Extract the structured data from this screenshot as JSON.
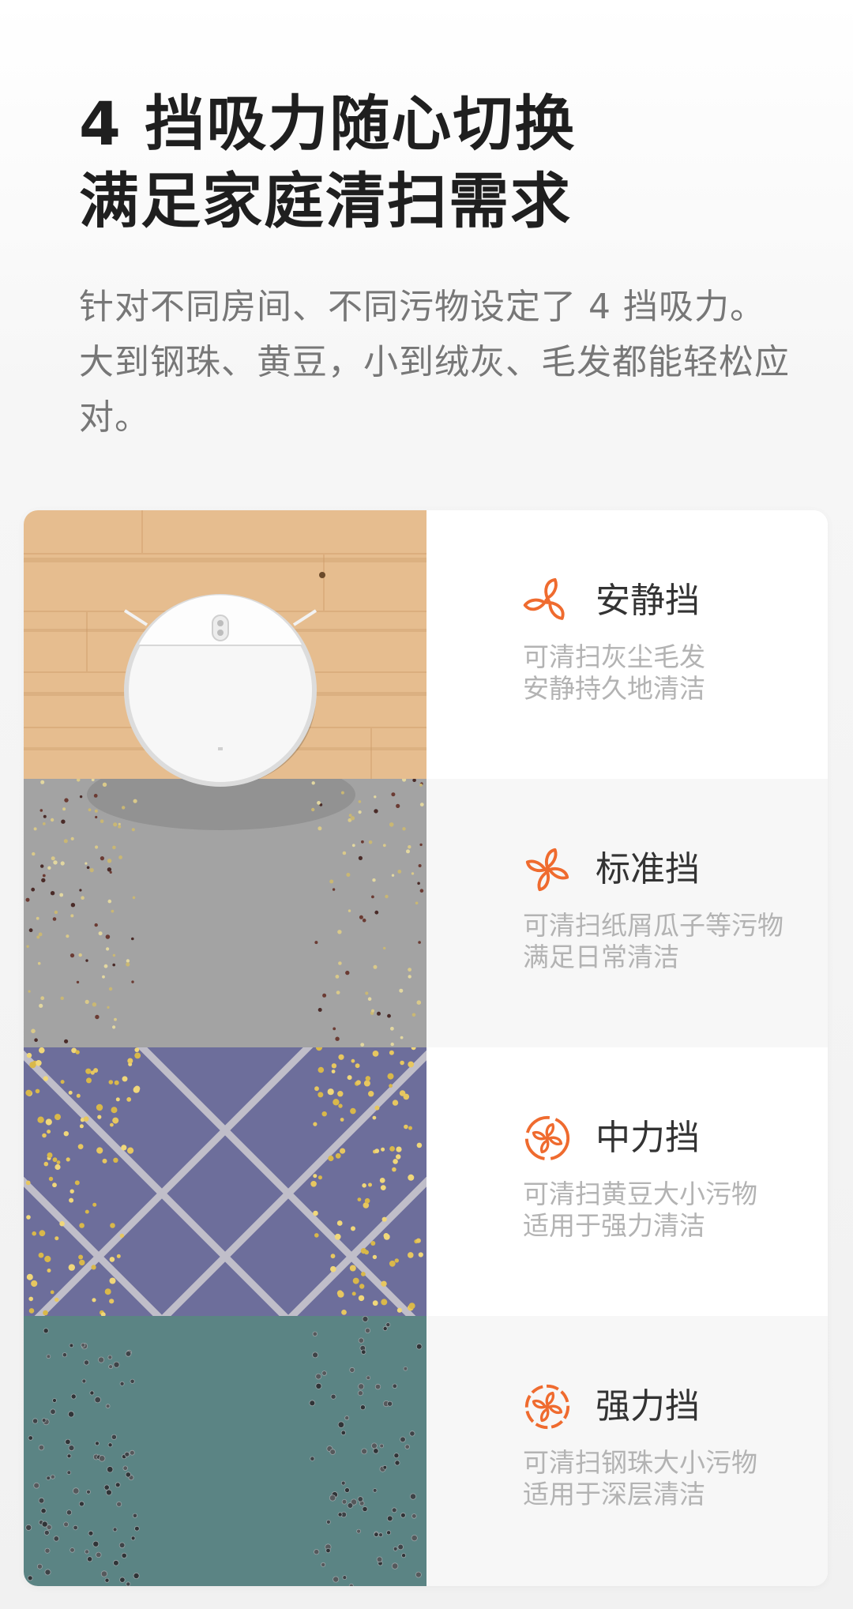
{
  "header": {
    "title_lines": [
      "4 挡吸力随心切换",
      "满足家庭清扫需求"
    ],
    "description": "针对不同房间、不同污物设定了 4 挡吸力。大到钢珠、黄豆，小到绒灰、毛发都能轻松应对。"
  },
  "modes": [
    {
      "icon": "fan-2-blade-icon",
      "name": "安静挡",
      "desc_lines": [
        "可清扫灰尘毛发",
        "安静持久地清洁"
      ],
      "floor": "wood"
    },
    {
      "icon": "fan-4-blade-icon",
      "name": "标准挡",
      "desc_lines": [
        "可清扫纸屑瓜子等污物",
        "满足日常清洁"
      ],
      "floor": "concrete-with-seeds"
    },
    {
      "icon": "fan-ring-icon",
      "name": "中力挡",
      "desc_lines": [
        "可清扫黄豆大小污物",
        "适用于强力清洁"
      ],
      "floor": "purple-carpet-with-beans"
    },
    {
      "icon": "fan-ring-strong-icon",
      "name": "强力挡",
      "desc_lines": [
        "可清扫钢珠大小污物",
        "适用于深层清洁"
      ],
      "floor": "teal-carpet-with-steel-balls"
    }
  ],
  "colors": {
    "accent": "#ef6b2f",
    "title": "#1f1f1f",
    "body_text": "#777777",
    "sub_text": "#b3b3b3",
    "wood": "#e7bf92",
    "concrete": "#a7a7a7",
    "purple_carpet": "#6e6f9c",
    "teal_carpet": "#5c8585"
  }
}
